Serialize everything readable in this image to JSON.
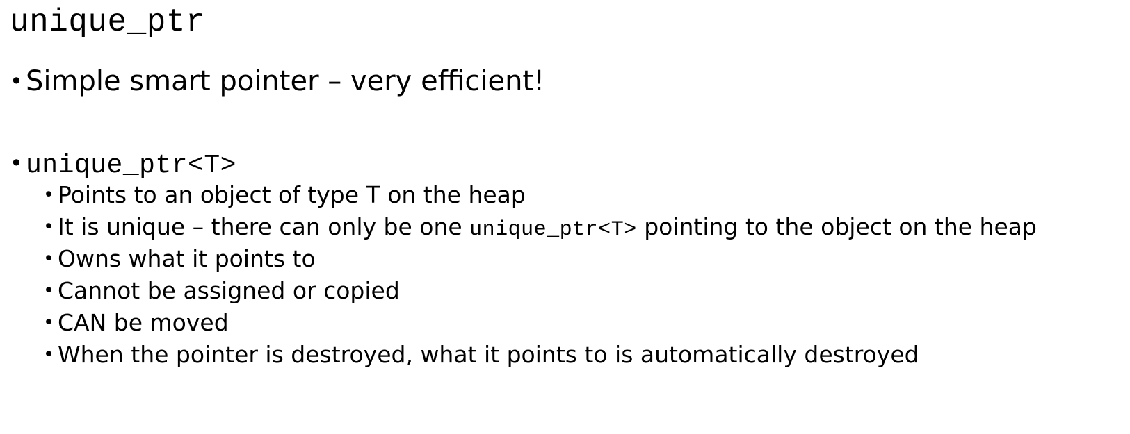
{
  "slide": {
    "title": "unique_ptr",
    "bullets": [
      {
        "text": "Simple smart pointer – very efficient!"
      },
      {
        "code": "unique_ptr<T>"
      }
    ],
    "sub_bullets": [
      {
        "text": "Points to an object of type T on the heap"
      },
      {
        "before": "It is unique – there can only be one ",
        "code": "unique_ptr<T>",
        "after": " pointing to the object on the heap"
      },
      {
        "text": "Owns what it points to"
      },
      {
        "text": "Cannot be assigned or copied"
      },
      {
        "text": "CAN be moved"
      },
      {
        "text": "When the pointer is destroyed, what it points to is automatically destroyed"
      }
    ],
    "bullet_glyph": "•"
  }
}
